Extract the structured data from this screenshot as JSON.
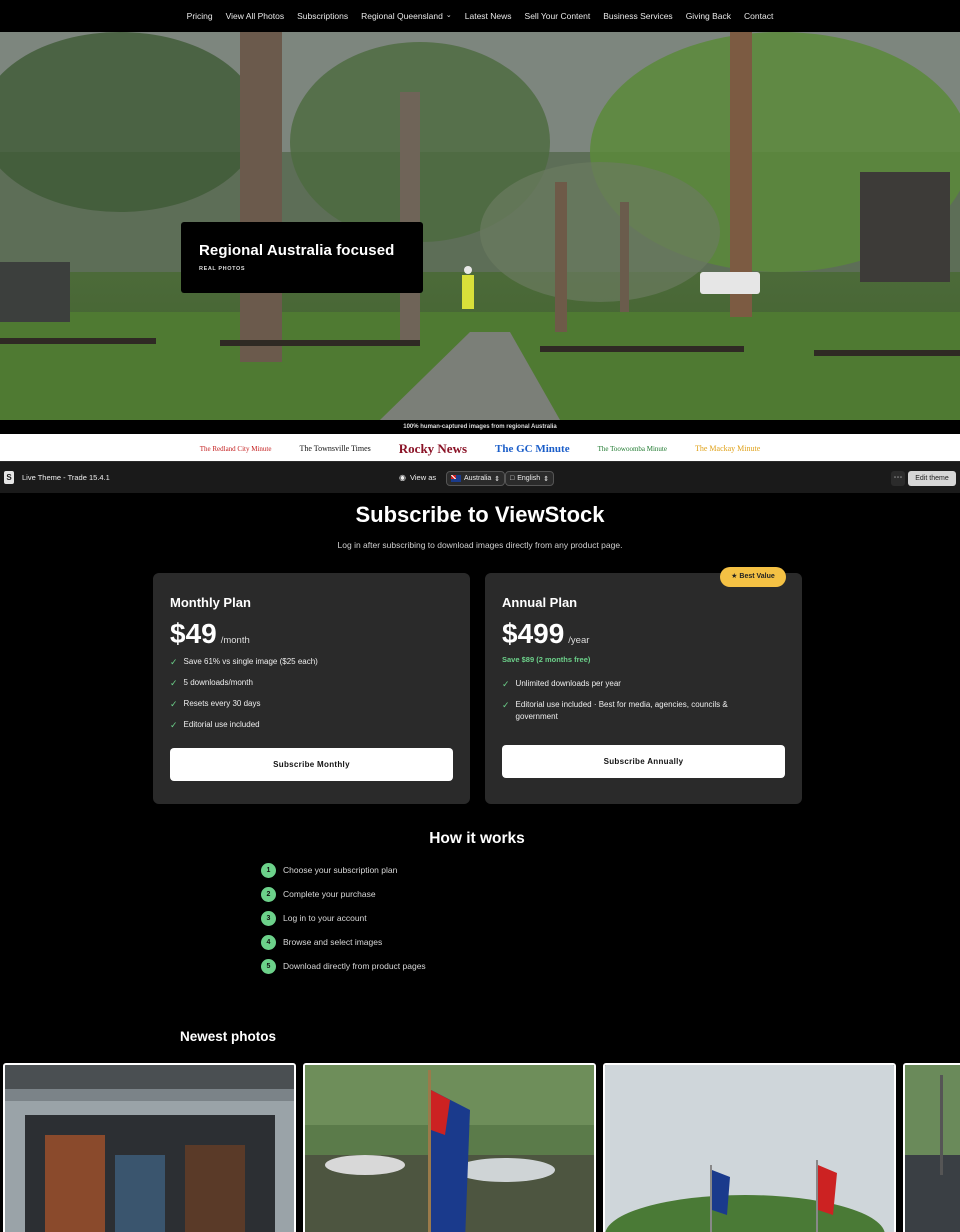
{
  "nav": {
    "items": [
      {
        "label": "Pricing"
      },
      {
        "label": "View All Photos"
      },
      {
        "label": "Subscriptions"
      },
      {
        "label": "Regional Queensland",
        "dropdown": true
      },
      {
        "label": "Latest News"
      },
      {
        "label": "Sell Your Content"
      },
      {
        "label": "Business Services"
      },
      {
        "label": "Giving Back"
      },
      {
        "label": "Contact"
      }
    ]
  },
  "hero": {
    "title": "Regional Australia focused",
    "subtitle": "REAL PHOTOS",
    "caption": "100% human-captured images from regional Australia"
  },
  "logos": [
    "The Redland City Minute",
    "The Townsville Times",
    "Rocky News",
    "The GC Minute",
    "The Toowoomba Minute",
    "The Mackay Minute"
  ],
  "admin": {
    "theme_label": "Live Theme - Trade 15.4.1",
    "view_as_label": "View as",
    "country": "Australia",
    "language": "English",
    "more_icon": "ellipsis-icon",
    "edit_label": "Edit theme"
  },
  "subscribe": {
    "title": "Subscribe to ViewStock",
    "description": "Log in after subscribing to download images directly from any product page.",
    "monthly": {
      "name": "Monthly Plan",
      "price": "$49",
      "period": "/month",
      "features": [
        "Save 61% vs single image ($25 each)",
        "5 downloads/month",
        "Resets every 30 days",
        "Editorial use included"
      ],
      "cta": "Subscribe Monthly"
    },
    "annual": {
      "badge": "★ Best Value",
      "name": "Annual Plan",
      "price": "$499",
      "period": "/year",
      "save_note": "Save $89 (2 months free)",
      "features": [
        "Unlimited downloads per year",
        "Editorial use included · Best for media, agencies, councils & government"
      ],
      "cta": "Subscribe Annually"
    }
  },
  "how": {
    "title": "How it works",
    "steps": [
      {
        "num": "1",
        "text": "Choose your subscription plan"
      },
      {
        "num": "2",
        "text": "Complete your purchase"
      },
      {
        "num": "3",
        "text": "Log in to your account"
      },
      {
        "num": "4",
        "text": "Browse and select images"
      },
      {
        "num": "5",
        "text": "Download directly from product pages"
      }
    ]
  },
  "newest": {
    "title": "Newest photos"
  },
  "colors": {
    "accent_green": "#6cd18a",
    "badge_gold": "#f4c144",
    "card_bg": "#2a2a2a"
  }
}
